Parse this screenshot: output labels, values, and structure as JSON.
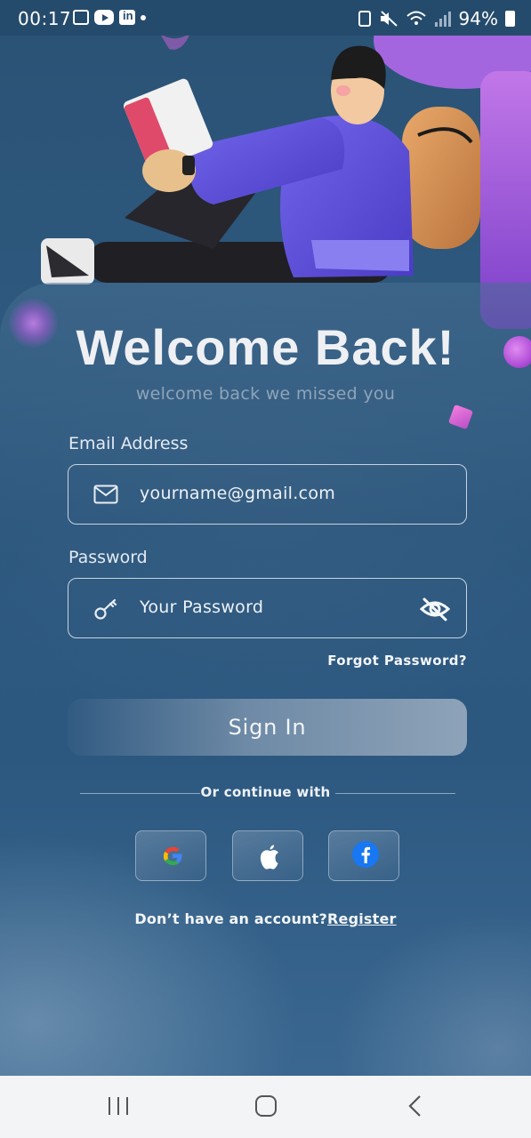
{
  "status_bar": {
    "time": "00:17",
    "battery": "94%",
    "icons": [
      "gallery-icon",
      "youtube-icon",
      "linkedin-icon",
      "mute-icon",
      "wifi-icon",
      "signal-icon",
      "battery-icon"
    ]
  },
  "login": {
    "title": "Welcome Back!",
    "subtitle": "welcome back we missed you",
    "email_label": "Email Address",
    "email_value": "yourname@gmail.com",
    "password_label": "Password",
    "password_placeholder": "Your Password",
    "forgot_password": "Forgot Password?",
    "sign_in": "Sign In",
    "or_continue": "Or continue with",
    "no_account": "Don’t have an account?",
    "register": "Register"
  },
  "social_buttons": [
    "google-icon",
    "apple-icon",
    "facebook-icon"
  ],
  "colors": {
    "background": "#2b557c",
    "google_blue": "#4285F4",
    "google_red": "#EA4335",
    "google_yellow": "#FBBC05",
    "google_green": "#34A853",
    "facebook_blue": "#1877F2"
  },
  "nav_bar": [
    "recents-icon",
    "home-icon",
    "back-icon"
  ]
}
